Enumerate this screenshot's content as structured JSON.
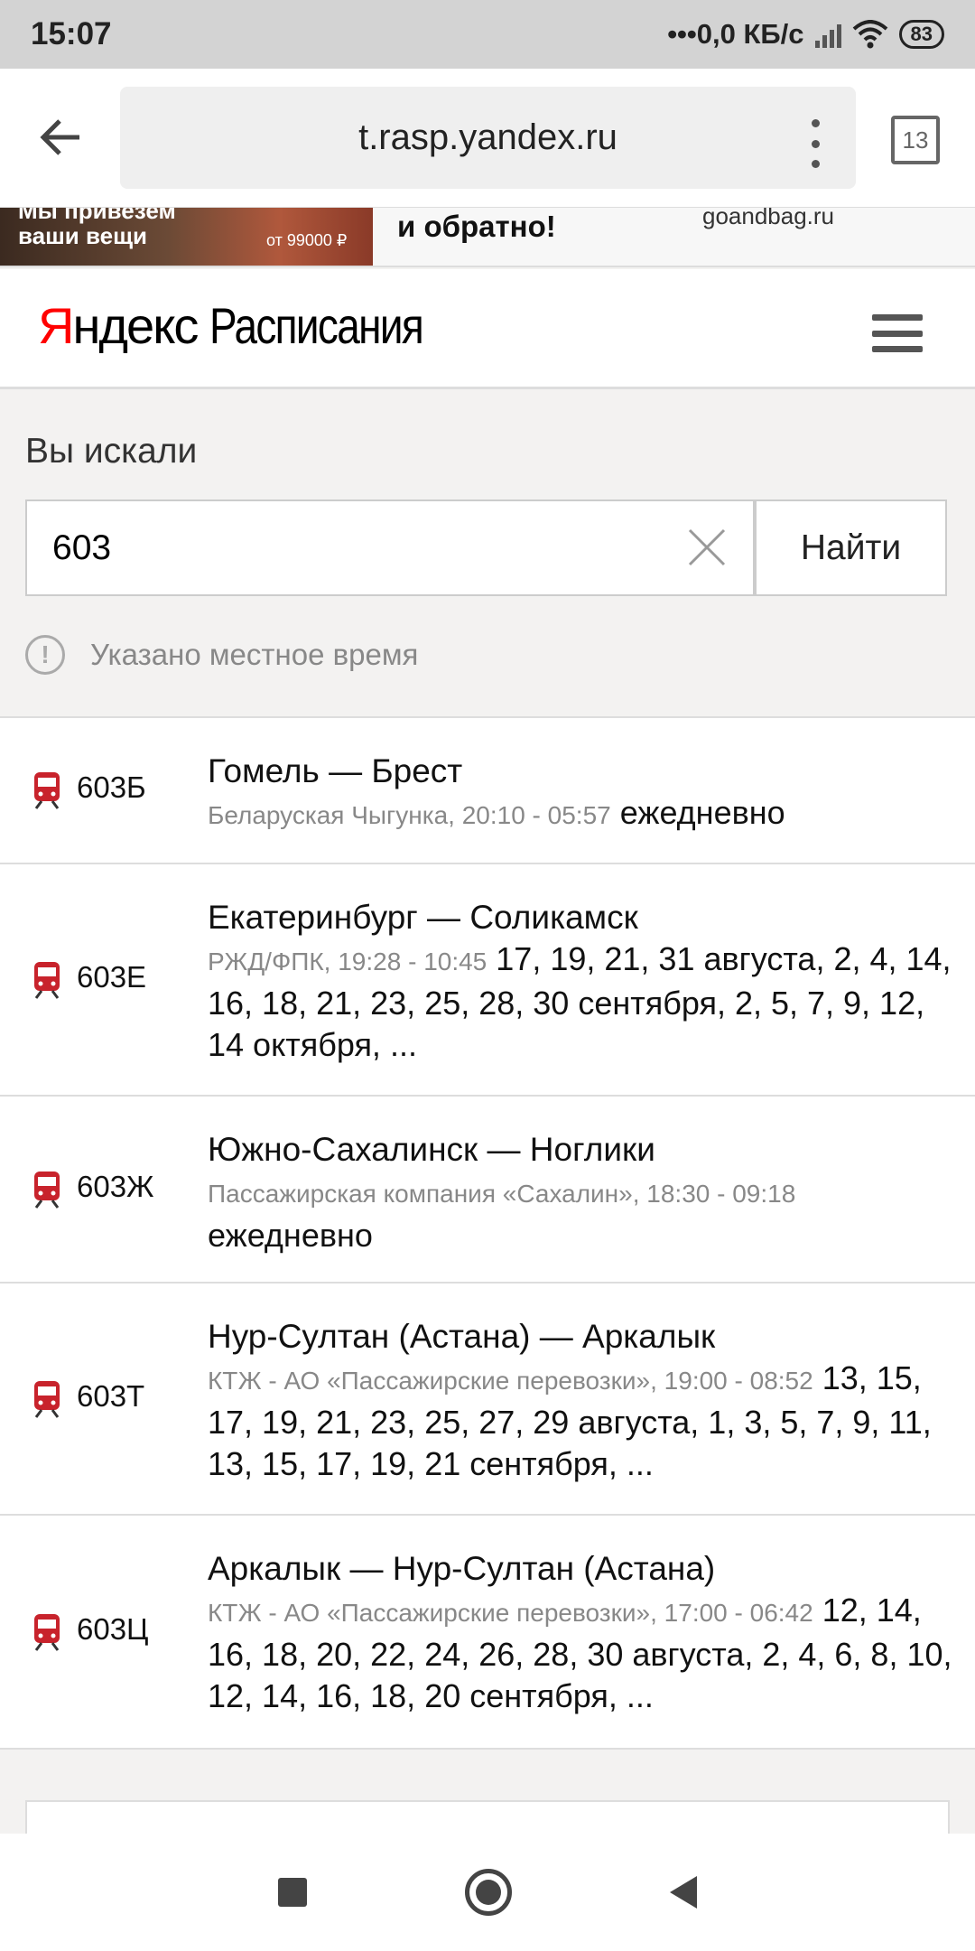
{
  "status_bar": {
    "time": "15:07",
    "network_speed": "•••0,0 КБ/с",
    "battery": "83"
  },
  "browser": {
    "url": "t.rasp.yandex.ru",
    "tab_count": "13"
  },
  "ad": {
    "image_line1": "Мы привезем",
    "image_line2": "ваши вещи",
    "image_price": "от 99000 ₽",
    "headline": "и обратно!",
    "domain": "goandbag.ru"
  },
  "header": {
    "logo_first": "Я",
    "logo_rest": "ндекс",
    "service": "Расписания"
  },
  "search": {
    "label": "Вы искали",
    "value": "603",
    "button": "Найти",
    "notice": "Указано местное время"
  },
  "results": [
    {
      "number": "603Б",
      "route": "Гомель — Брест",
      "carrier_time": "Беларуская Чыгунка, 20:10 - 05:57",
      "days": "ежедневно"
    },
    {
      "number": "603Е",
      "route": "Екатеринбург — Соликамск",
      "carrier_time": "РЖД/ФПК, 19:28 - 10:45",
      "days": "17, 19, 21, 31 августа, 2, 4, 14, 16, 18, 21, 23, 25, 28, 30 сентября, 2, 5, 7, 9, 12, 14 октября, ..."
    },
    {
      "number": "603Ж",
      "route": "Южно-Сахалинск — Ноглики",
      "carrier_time": "Пассажирская компания «Сахалин», 18:30 - 09:18",
      "days": "ежедневно"
    },
    {
      "number": "603Т",
      "route": "Нур-Султан (Астана) — Аркалык",
      "carrier_time": "КТЖ - АО «Пассажирские перевозки», 19:00 - 08:52",
      "days": "13, 15, 17, 19, 21, 23, 25, 27, 29 августа, 1, 3, 5, 7, 9, 11, 13, 15, 17, 19, 21 сентября, ..."
    },
    {
      "number": "603Ц",
      "route": "Аркалык — Нур-Султан (Астана)",
      "carrier_time": "КТЖ - АО «Пассажирские перевозки», 17:00 - 06:42",
      "days": "12, 14, 16, 18, 20, 22, 24, 26, 28, 30 августа, 2, 4, 6, 8, 10, 12, 14, 16, 18, 20 сентября, ..."
    }
  ],
  "colors": {
    "brand_red": "#ff0000",
    "train_icon": "#c8232c",
    "muted_text": "#888888"
  }
}
